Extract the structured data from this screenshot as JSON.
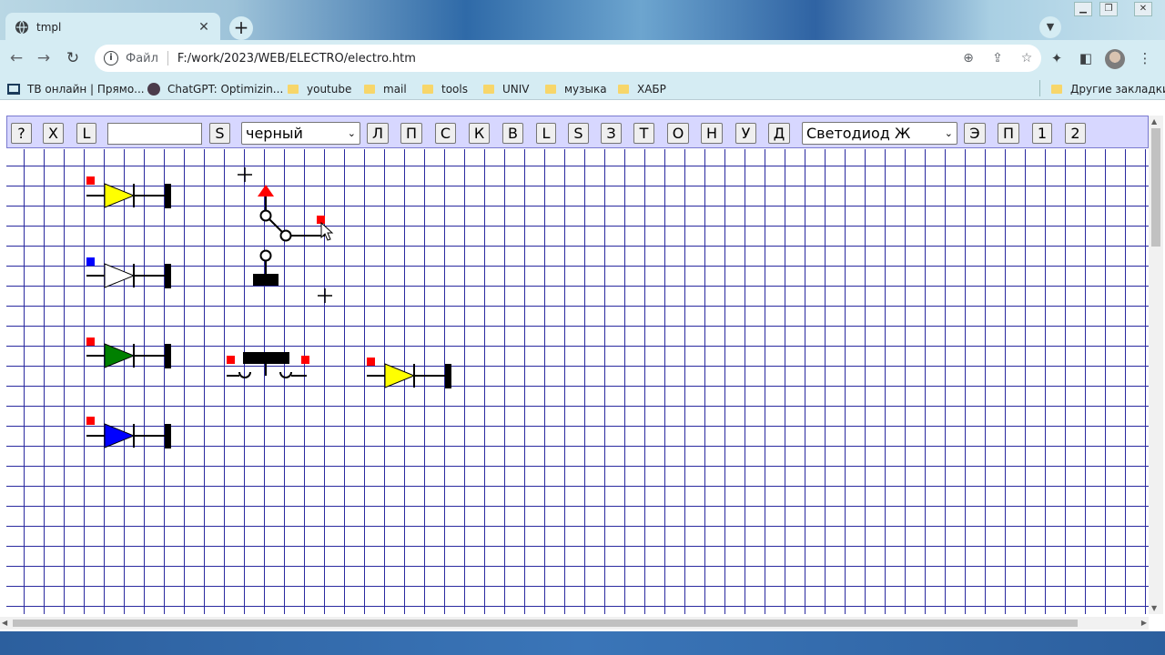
{
  "browser": {
    "tab_title": "tmpl",
    "site_label": "Файл",
    "url": "F:/work/2023/WEB/ELECTRO/electro.htm",
    "bookmarks": [
      {
        "label": "ТВ онлайн | Прямо...",
        "icon": "tv-icon"
      },
      {
        "label": "ChatGPT: Optimizin...",
        "icon": "chatgpt-icon"
      },
      {
        "label": "youtube",
        "icon": "folder-icon"
      },
      {
        "label": "mail",
        "icon": "folder-icon"
      },
      {
        "label": "tools",
        "icon": "folder-icon"
      },
      {
        "label": "UNIV",
        "icon": "folder-icon"
      },
      {
        "label": "музыка",
        "icon": "folder-icon"
      },
      {
        "label": "ХАБР",
        "icon": "folder-icon"
      }
    ],
    "other_bookmarks": "Другие закладки"
  },
  "app": {
    "buttons_left": [
      "?",
      "X",
      "L"
    ],
    "text_input_value": "",
    "save_button": "S",
    "color_select": "черный",
    "tool_buttons": [
      "Л",
      "П",
      "С",
      "К",
      "В",
      "L",
      "S",
      "З",
      "Т",
      "О",
      "Н",
      "У",
      "Д"
    ],
    "component_select": "Светодиод Ж",
    "buttons_right": [
      "Э",
      "П",
      "1",
      "2"
    ]
  },
  "schematic": {
    "grid_color": "#2a2aa0",
    "components": [
      {
        "type": "led",
        "fill": "#ffff00",
        "marker": "#ff0000"
      },
      {
        "type": "led",
        "fill": "#ffffff",
        "marker": "#0000ff"
      },
      {
        "type": "led",
        "fill": "#008000",
        "marker": "#ff0000"
      },
      {
        "type": "led",
        "fill": "#0000ff",
        "marker": "#ff0000"
      },
      {
        "type": "switch",
        "marker": "#ff0000"
      },
      {
        "type": "button",
        "marker": "#ff0000"
      },
      {
        "type": "led",
        "fill": "#ffff00",
        "marker": "#ff0000"
      }
    ]
  }
}
